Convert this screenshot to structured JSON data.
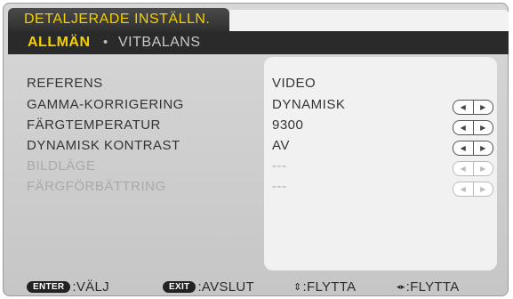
{
  "title": "DETALJERADE INSTÄLLN.",
  "tabs": {
    "active": "ALLMÄN",
    "separator": "•",
    "inactive": "VITBALANS"
  },
  "settings": [
    {
      "label": "REFERENS",
      "value": "VIDEO",
      "has_arrows": false,
      "enabled": true
    },
    {
      "label": "GAMMA-KORRIGERING",
      "value": "DYNAMISK",
      "has_arrows": true,
      "enabled": true
    },
    {
      "label": "FÄRGTEMPERATUR",
      "value": "9300",
      "has_arrows": true,
      "enabled": true
    },
    {
      "label": "DYNAMISK KONTRAST",
      "value": "AV",
      "has_arrows": true,
      "enabled": true
    },
    {
      "label": "BILDLÄGE",
      "value": "---",
      "has_arrows": true,
      "enabled": false
    },
    {
      "label": "FÄRGFÖRBÄTTRING",
      "value": "---",
      "has_arrows": true,
      "enabled": false
    }
  ],
  "arrow_glyphs": {
    "left": "◀",
    "right": "▶"
  },
  "footer": {
    "enter_key": "ENTER",
    "enter_text": ":VÄLJ",
    "exit_key": "EXIT",
    "exit_text": ":AVSLUT",
    "updown_glyph": "⇕",
    "updown_text": ":FLYTTA",
    "leftright_glyph": "◂▸",
    "leftright_text": ":FLYTTA"
  },
  "colors": {
    "accent": "#f5d000",
    "tab_bar": "#2a2a2a",
    "frame": "#cfcfcf",
    "panel": "#f1f1f1"
  }
}
